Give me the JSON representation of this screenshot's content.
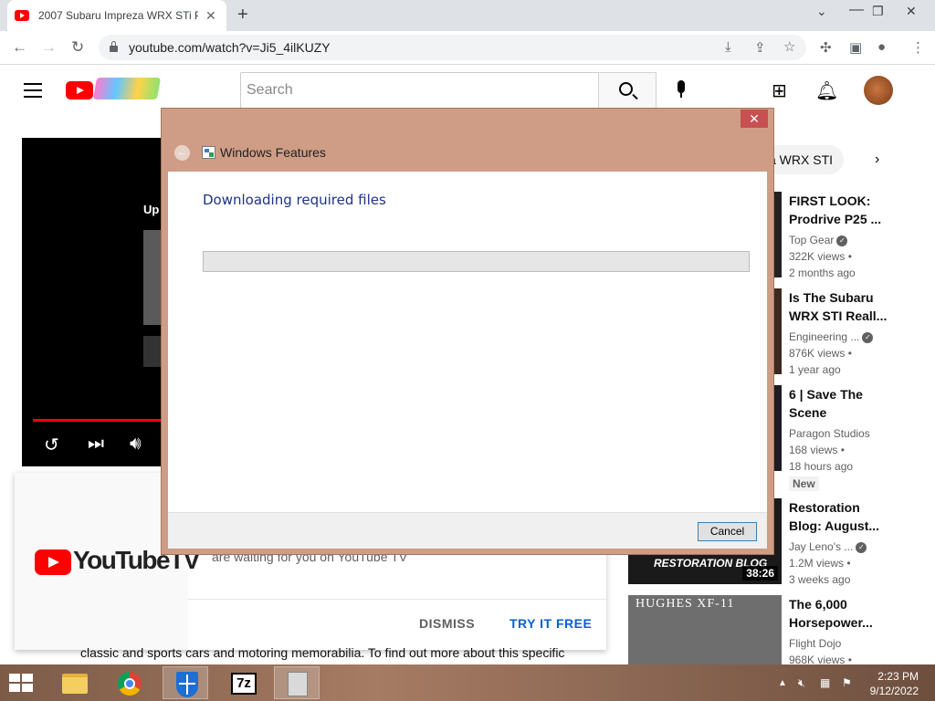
{
  "browser": {
    "tab_title": "2007 Subaru Impreza WRX STi P",
    "tab_close": "✕",
    "new_tab": "+",
    "url": "youtube.com/watch?v=Ji5_4ilKUZY",
    "window_controls": {
      "minimize": "⌄",
      "restore": "❐",
      "close": "✕"
    }
  },
  "youtube": {
    "search_placeholder": "Search",
    "up_next_label": "Up",
    "chip_label": "a WRX STI",
    "chip_arrow": "›",
    "sidebar": [
      {
        "title": "FIRST LOOK: Prodrive P25 ...",
        "channel": "Top Gear",
        "verified": true,
        "views": "322K views •",
        "age": "2 months ago",
        "badge": "",
        "thumb_caption": "",
        "duration": ""
      },
      {
        "title": "Is The Subaru WRX STI Reall...",
        "channel": "Engineering ...",
        "verified": true,
        "views": "876K views •",
        "age": "1 year ago",
        "badge": "",
        "thumb_caption": "",
        "duration": ""
      },
      {
        "title": "6 | Save The Scene",
        "channel": "Paragon Studios",
        "verified": false,
        "views": "168 views •",
        "age": "18 hours ago",
        "badge": "New",
        "thumb_caption": "",
        "duration": ""
      },
      {
        "title": "Restoration Blog: August...",
        "channel": "Jay Leno's ...",
        "verified": true,
        "views": "1.2M views •",
        "age": "3 weeks ago",
        "badge": "",
        "thumb_caption": "RESTORATION BLOG",
        "duration": "38:26"
      },
      {
        "title": "The 6,000 Horsepower...",
        "channel": "Flight Dojo",
        "verified": false,
        "views": "968K views •",
        "age": "",
        "badge": "",
        "thumb_caption": "HUGHES XF-11",
        "duration": ""
      }
    ],
    "promo": {
      "logo_text": "YouTubeTV",
      "body_text": "are waiting for you on YouTube TV",
      "dismiss": "DISMISS",
      "try_free": "TRY IT FREE"
    },
    "behind_text": "classic and sports cars and motoring memorabilia. To find out more about this specific"
  },
  "dialog": {
    "title": "Windows Features",
    "close": "✕",
    "back": "←",
    "heading": "Downloading required files",
    "progress": 0,
    "cancel": "Cancel"
  },
  "taskbar": {
    "time": "2:23 PM",
    "date": "9/12/2022",
    "sevenzip_label": "7z"
  }
}
